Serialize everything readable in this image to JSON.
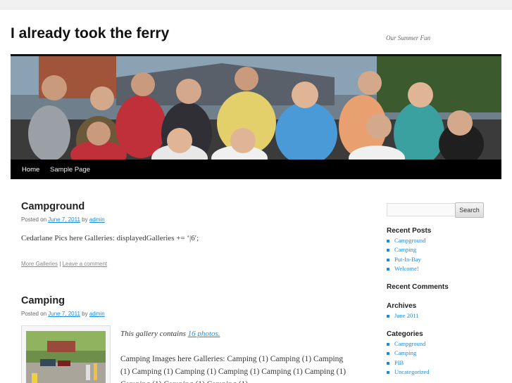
{
  "site": {
    "title": "I already took the ferry",
    "description": "Our Summer Fun"
  },
  "nav": {
    "items": [
      "Home",
      "Sample Page"
    ]
  },
  "posts": [
    {
      "title": "Campground",
      "posted_on_label": "Posted on",
      "date": "June 7, 2011",
      "by_label": "by",
      "author": "admin",
      "excerpt": "Cedarlane Pics here Galleries: displayedGalleries += ‘|6′;",
      "more_link": "More Galleries",
      "separator": "|",
      "comment_link": "Leave a comment"
    },
    {
      "title": "Camping",
      "posted_on_label": "Posted on",
      "date": "June 7, 2011",
      "by_label": "by",
      "author": "admin",
      "gallery_prefix": "This gallery contains",
      "gallery_link": "16 photos.",
      "gallery_text": "Camping Images here Galleries: Camping (1) Camping (1) Camping (1) Camping (1) Camping (1) Camping (1) Camping (1) Camping (1) Camping (1) Camping (1) Camping (1)"
    }
  ],
  "sidebar": {
    "search_placeholder": "",
    "search_button": "Search",
    "recent_posts_title": "Recent Posts",
    "recent_posts": [
      "Campground",
      "Camping",
      "Put-In-Bay",
      "Welcome!"
    ],
    "recent_comments_title": "Recent Comments",
    "archives_title": "Archives",
    "archives": [
      "June 2011"
    ],
    "categories_title": "Categories",
    "categories": [
      "Campground",
      "Camping",
      "PIB",
      "Uncategorized"
    ]
  },
  "colors": {
    "link": "#1b8be0",
    "nav_bg": "#000000",
    "text": "#373737"
  }
}
